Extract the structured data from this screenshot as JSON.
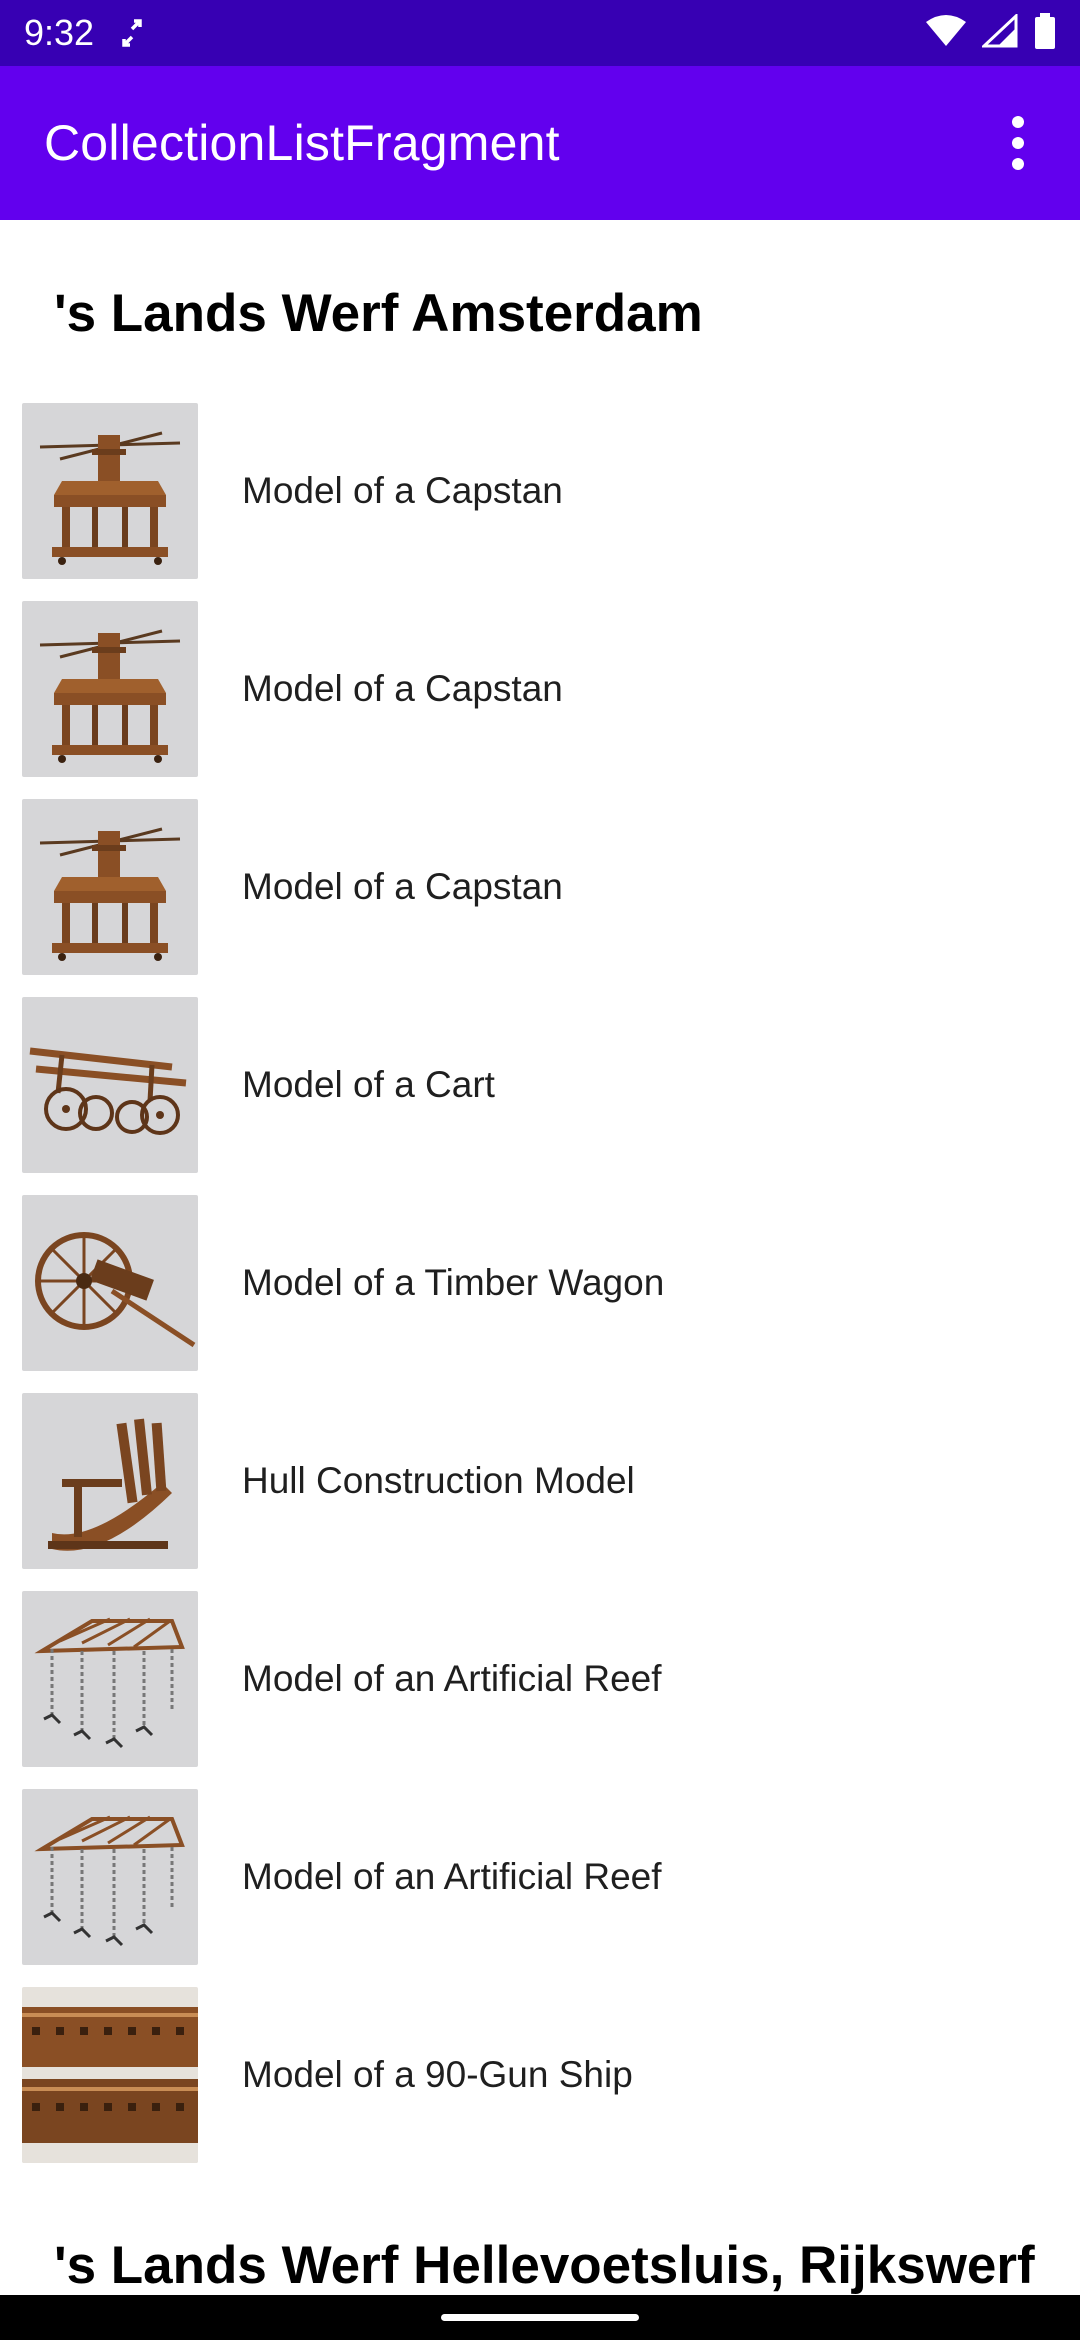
{
  "status_bar": {
    "time": "9:32",
    "icons": [
      "sync-icon",
      "wifi-icon",
      "signal-icon",
      "battery-icon"
    ]
  },
  "app_bar": {
    "title": "CollectionListFragment",
    "menu_icon": "overflow-menu-icon"
  },
  "sections": [
    {
      "title": "'s Lands Werf Amsterdam",
      "items": [
        {
          "label": "Model of a Capstan",
          "image": "capstan"
        },
        {
          "label": "Model of a Capstan",
          "image": "capstan"
        },
        {
          "label": "Model of a Capstan",
          "image": "capstan"
        },
        {
          "label": "Model of a Cart",
          "image": "cart"
        },
        {
          "label": "Model of a Timber Wagon",
          "image": "timber-wagon"
        },
        {
          "label": "Hull Construction Model",
          "image": "hull"
        },
        {
          "label": "Model of an Artificial Reef",
          "image": "reef"
        },
        {
          "label": "Model of an Artificial Reef",
          "image": "reef"
        },
        {
          "label": "Model of a 90-Gun Ship",
          "image": "ship"
        }
      ]
    },
    {
      "title": "'s Lands Werf Hellevoetsluis, Rijkswerf",
      "items": []
    }
  ],
  "colors": {
    "status_bar": "#3700b3",
    "app_bar": "#6200ee",
    "thumb_background": "#d6d6d8",
    "wood": "#8a4f25"
  }
}
